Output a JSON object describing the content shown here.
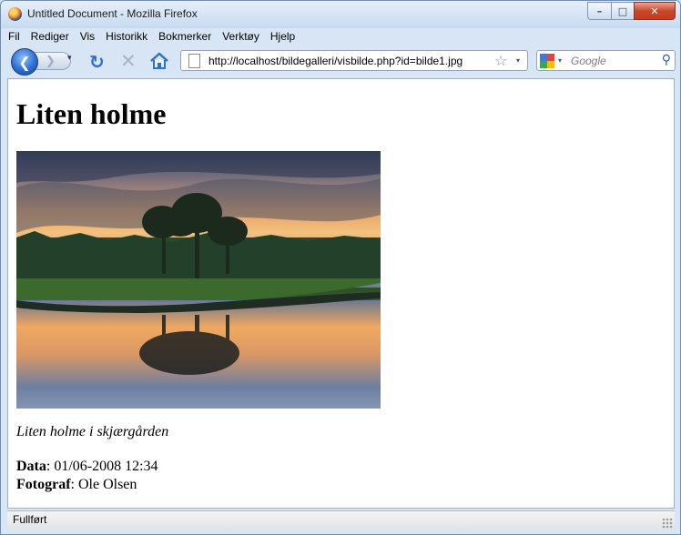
{
  "window": {
    "title": "Untitled Document - Mozilla Firefox",
    "controls": {
      "minimize": "–",
      "maximize": "□",
      "close": "✕"
    }
  },
  "menu": [
    "Fil",
    "Rediger",
    "Vis",
    "Historikk",
    "Bokmerker",
    "Verktøy",
    "Hjelp"
  ],
  "toolbar": {
    "back_glyph": "❮",
    "forward_glyph": "❯",
    "dropdown_glyph": "▾",
    "reload_glyph": "↻",
    "stop_glyph": "✕",
    "url": "http://localhost/bildegalleri/visbilde.php?id=bilde1.jpg",
    "bookmark_glyph": "☆",
    "search_placeholder": "Google",
    "search_go_glyph": "⚲"
  },
  "page": {
    "heading": "Liten holme",
    "caption": "Liten holme i skjærgården",
    "date_label": "Data",
    "date_value": ": 01/06-2008 12:34",
    "photographer_label": "Fotograf",
    "photographer_value": ": Ole Olsen"
  },
  "status": "Fullført",
  "colors": {
    "accent": "#2e6fd1",
    "close_button": "#c8482b"
  }
}
